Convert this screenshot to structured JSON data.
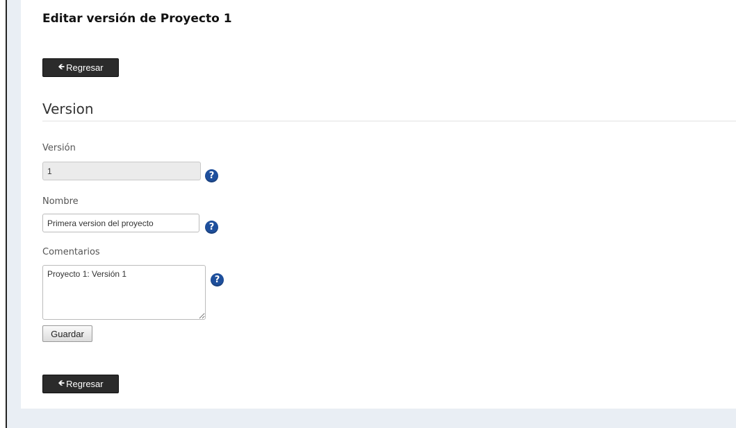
{
  "page": {
    "title": "Editar versión de Proyecto 1",
    "back_label": "Regresar",
    "back_icon": "arrow-left-icon"
  },
  "section": {
    "title": "Version"
  },
  "form": {
    "version": {
      "label": "Versión",
      "value": "1",
      "readonly": true
    },
    "nombre": {
      "label": "Nombre",
      "value": "Primera version del proyecto"
    },
    "comentarios": {
      "label": "Comentarios",
      "value": "Proyecto 1: Versión 1"
    },
    "help_icon_text": "?",
    "save_label": "Guardar"
  },
  "colors": {
    "help_icon": "#1e4f9c",
    "back_button": "#2b2b2b",
    "page_background": "#e9eef4"
  }
}
